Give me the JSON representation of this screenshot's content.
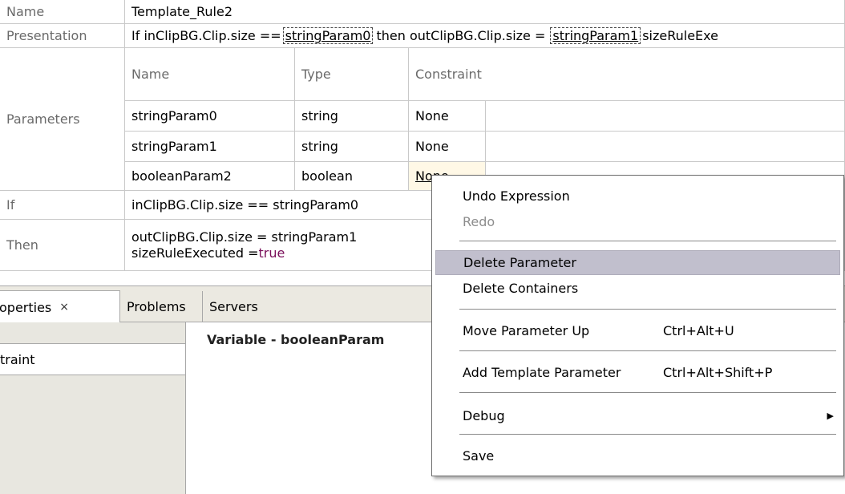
{
  "rule": {
    "name_label": "Name",
    "name_value": "Template_Rule2",
    "presentation_label": "Presentation",
    "presentation": {
      "prefix": "If inClipBG.Clip.size ==",
      "param0": "stringParam0",
      "middle": "then outClipBG.Clip.size =",
      "param1": "stringParam1",
      "suffix": "sizeRuleExe"
    },
    "parameters_label": "Parameters",
    "param_headers": {
      "name": "Name",
      "type": "Type",
      "constraint": "Constraint"
    },
    "params": [
      {
        "name": "stringParam0",
        "type": "string",
        "constraint": "None"
      },
      {
        "name": "stringParam1",
        "type": "string",
        "constraint": "None"
      },
      {
        "name": "booleanParam2",
        "type": "boolean",
        "constraint": "None"
      }
    ],
    "if_label": "If",
    "if_value": "inClipBG.Clip.size == stringParam0",
    "then_label": "Then",
    "then_line1": "outClipBG.Clip.size = stringParam1",
    "then_line2_prefix": "sizeRuleExecuted =",
    "then_line2_value": "true"
  },
  "tabs": [
    {
      "label": "operties",
      "close_icon": "×"
    },
    {
      "label": "Problems"
    },
    {
      "label": "Servers"
    }
  ],
  "properties": {
    "left_item": "traint",
    "variable_title": "Variable - booleanParam"
  },
  "menu": {
    "undo": "Undo Expression",
    "redo": "Redo",
    "delete_parameter": "Delete Parameter",
    "delete_containers": "Delete Containers",
    "move_up": "Move Parameter Up",
    "move_up_shortcut": "Ctrl+Alt+U",
    "add_template": "Add Template Parameter",
    "add_template_shortcut": "Ctrl+Alt+Shift+P",
    "debug": "Debug",
    "save": "Save"
  },
  "colors": {
    "grid_line": "#c9c9c9",
    "header_text": "#6a6a6a",
    "menu_highlight": "#c1bfcd",
    "keyword_true": "#7a0f5a"
  }
}
